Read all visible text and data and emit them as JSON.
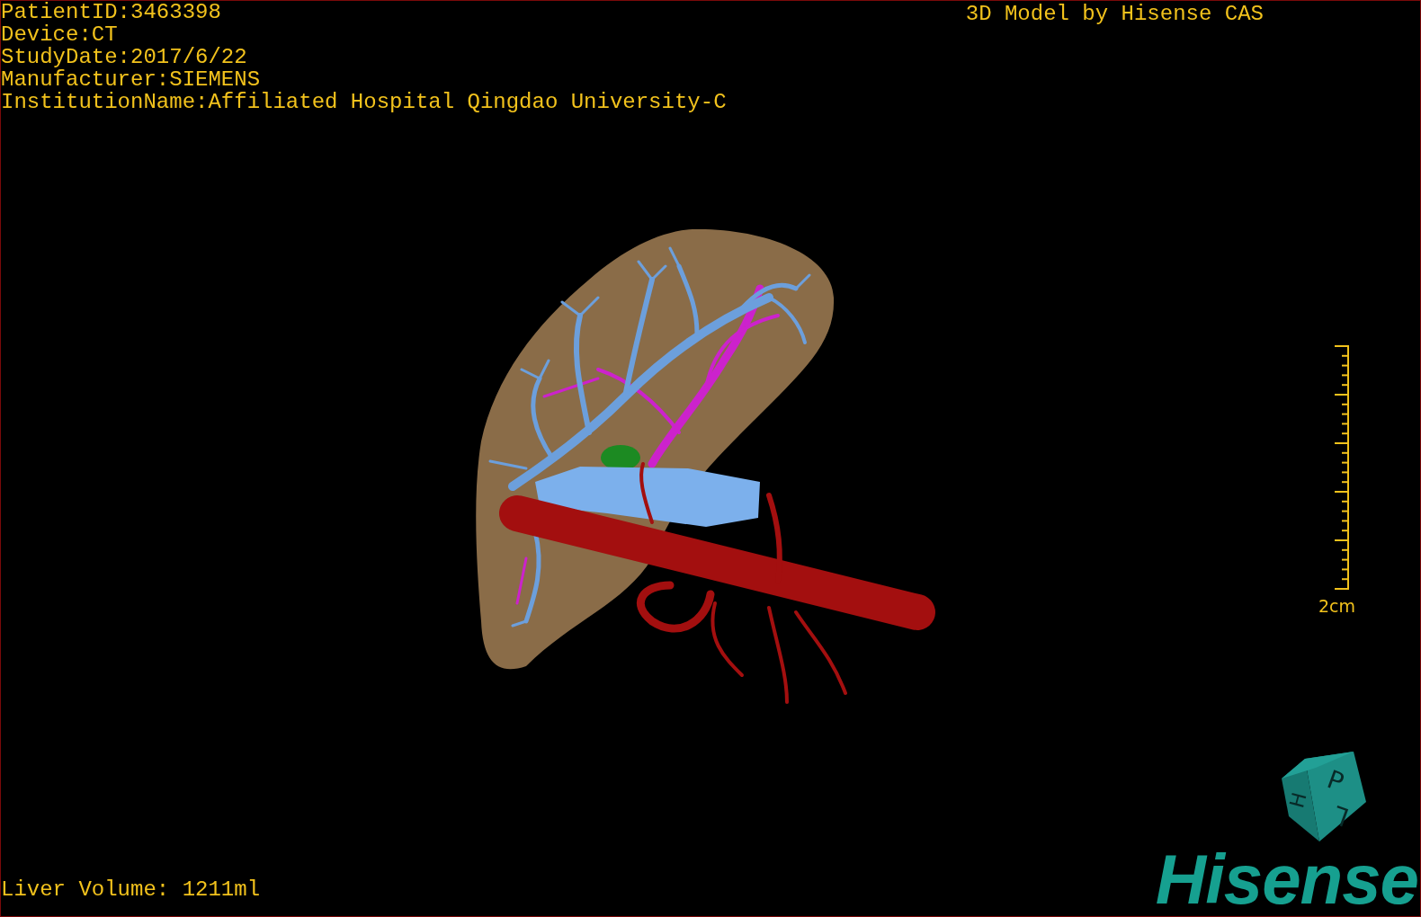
{
  "study_info": [
    "PatientID:3463398",
    "Device:CT",
    "StudyDate:2017/6/22",
    "Manufacturer:SIEMENS",
    "InstitutionName:Affiliated Hospital Qingdao University-C"
  ],
  "title": "3D Model by Hisense CAS",
  "scale": {
    "label": "2cm"
  },
  "volume": "Liver Volume: 1211ml",
  "orientation_cube": {
    "labels": [
      "P",
      "L",
      "H"
    ]
  },
  "logo": "Hisense"
}
